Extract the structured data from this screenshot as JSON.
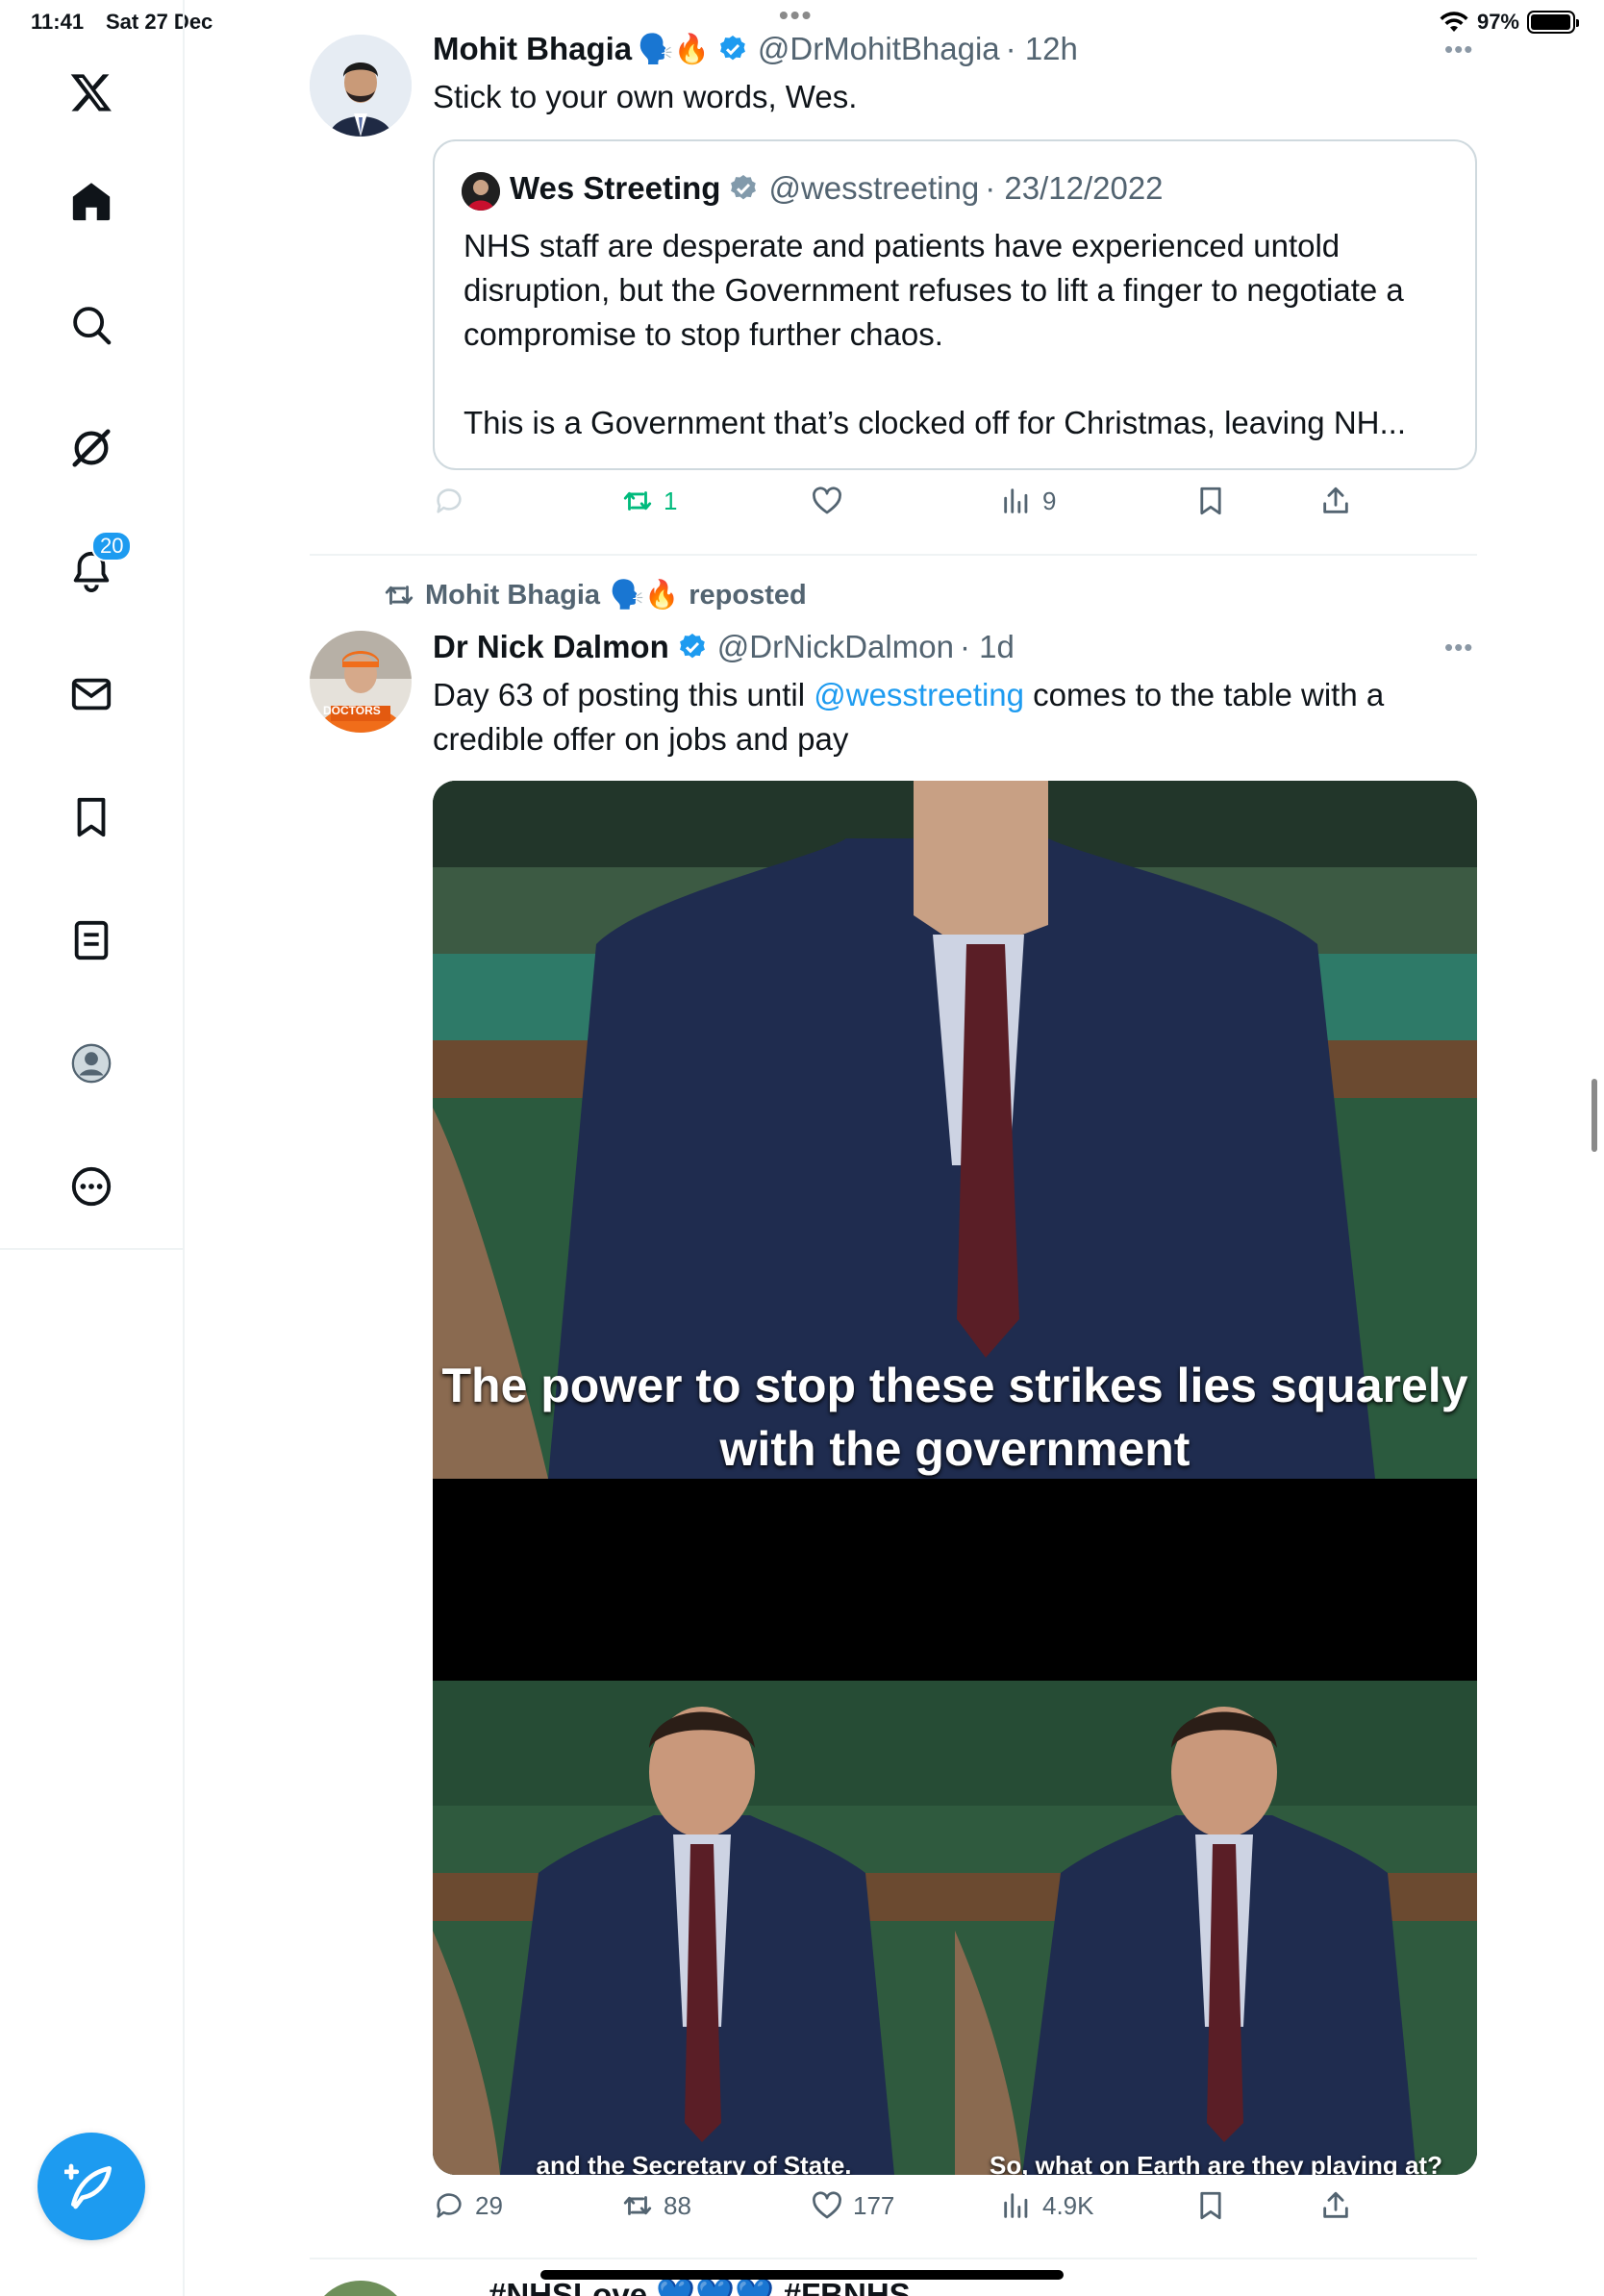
{
  "status_bar": {
    "time": "11:41",
    "date": "Sat 27 Dec",
    "battery": "97%",
    "battery_level": 0.97
  },
  "sidebar": {
    "items": [
      {
        "name": "home",
        "icon": "home-icon"
      },
      {
        "name": "explore",
        "icon": "search-icon"
      },
      {
        "name": "grok",
        "icon": "grok-icon"
      },
      {
        "name": "notifications",
        "icon": "bell-icon",
        "badge": "20"
      },
      {
        "name": "messages",
        "icon": "mail-icon"
      },
      {
        "name": "bookmarks",
        "icon": "bookmark-icon"
      },
      {
        "name": "lists",
        "icon": "list-icon"
      },
      {
        "name": "profile",
        "icon": "profile-icon"
      },
      {
        "name": "more",
        "icon": "more-circle-icon"
      }
    ],
    "compose_icon": "compose-feather-icon"
  },
  "tweets": [
    {
      "author_name": "Mohit Bhagia",
      "author_emoji": "🗣️🔥",
      "handle": "@DrMohitBhagia",
      "time": "· 12h",
      "text": "Stick to your own words, Wes.",
      "quote": {
        "author_name": "Wes Streeting",
        "handle": "@wesstreeting",
        "date": "· 23/12/2022",
        "text_1": "NHS staff are desperate and patients have experienced untold disruption, but the Government refuses to lift a finger to negotiate a compromise to stop further chaos.",
        "text_2": "This is a Government that’s clocked off for Christmas, leaving NH..."
      },
      "actions": {
        "replies": "",
        "reposts": "1",
        "likes": "",
        "views": "9"
      }
    },
    {
      "repost_by": "Mohit Bhagia",
      "repost_emoji": "🗣️🔥",
      "repost_label": "reposted",
      "author_name": "Dr Nick Dalmon",
      "handle": "@DrNickDalmon",
      "time": "· 1d",
      "text_before": "Day 63 of posting this until ",
      "mention": "@wesstreeting",
      "text_after": " comes to the table with a credible offer on jobs and pay",
      "avatar_label": "DOCTORS",
      "media": {
        "caption_main": "The power to stop these strikes lies squarely with the government",
        "caption_left": "and the Secretary of State.",
        "caption_right": "So, what on Earth are they playing at?"
      },
      "actions": {
        "replies": "29",
        "reposts": "88",
        "likes": "177",
        "views": "4.9K"
      }
    }
  ],
  "next_tweet_peek": "#NHSLove 💙💙💙 #FBNHS",
  "colors": {
    "accent": "#1d9bf0",
    "repost_green": "#00ba7c",
    "secondary_text": "#536471",
    "border": "#cfd9de"
  }
}
